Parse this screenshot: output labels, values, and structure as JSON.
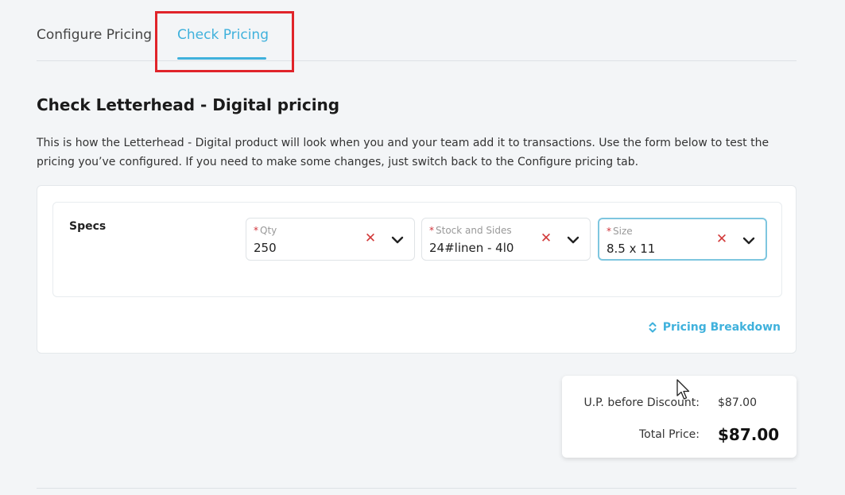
{
  "tabs": {
    "configure_label": "Configure Pricing",
    "check_label": "Check Pricing"
  },
  "page": {
    "title": "Check Letterhead - Digital pricing",
    "description": "This is how the Letterhead - Digital product will look when you and your team add it to transactions. Use the form below to test the pricing you’ve configured. If you need to make some changes, just switch back to the Configure pricing tab."
  },
  "specs": {
    "label": "Specs",
    "fields": [
      {
        "label": "Qty",
        "value": "250",
        "required_mark": "*"
      },
      {
        "label": "Stock and Sides",
        "value": "24#linen - 4l0",
        "required_mark": "*"
      },
      {
        "label": "Size",
        "value": "8.5 x 11",
        "required_mark": "*"
      }
    ],
    "clear_glyph": "✕"
  },
  "breakdown_label": "Pricing Breakdown",
  "summary": {
    "up_label": "U.P. before Discount:",
    "up_value": "$87.00",
    "total_label": "Total Price:",
    "total_value": "$87.00"
  },
  "colors": {
    "accent": "#3fb1dc",
    "clear_red": "#d23a3a",
    "highlight_red": "#e0242a"
  }
}
